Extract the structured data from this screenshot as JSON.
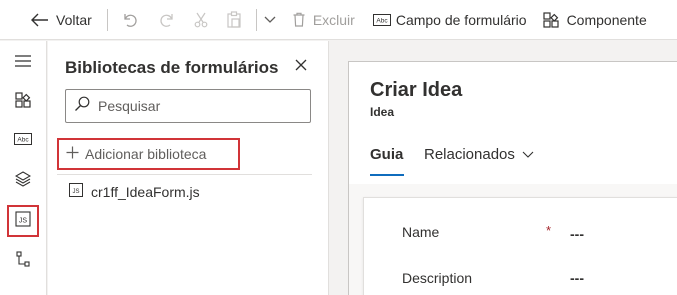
{
  "toolbar": {
    "back_label": "Voltar",
    "delete_label": "Excluir",
    "form_field_label": "Campo de formulário",
    "component_label": "Componente"
  },
  "rail": {
    "items": [
      "menu-icon",
      "components-icon",
      "text-field-icon",
      "layers-icon",
      "form-libraries-icon",
      "tree-view-icon"
    ],
    "active": "form-libraries-icon",
    "highlight_color": "#d13438"
  },
  "panel": {
    "title": "Bibliotecas de formulários",
    "search_placeholder": "Pesquisar",
    "add_library_label": "Adicionar biblioteca",
    "files": [
      {
        "name": "cr1ff_IdeaForm.js"
      }
    ]
  },
  "form": {
    "title": "Criar Idea",
    "subtitle": "Idea",
    "tabs": [
      {
        "label": "Guia",
        "selected": true
      },
      {
        "label": "Relacionados",
        "selected": false
      }
    ],
    "fields": [
      {
        "label": "Name",
        "required": true,
        "required_mark": "*",
        "value": "---"
      },
      {
        "label": "Description",
        "required": false,
        "value": "---"
      }
    ]
  },
  "colors": {
    "accent": "#0f6cbd",
    "highlight": "#d13438"
  }
}
